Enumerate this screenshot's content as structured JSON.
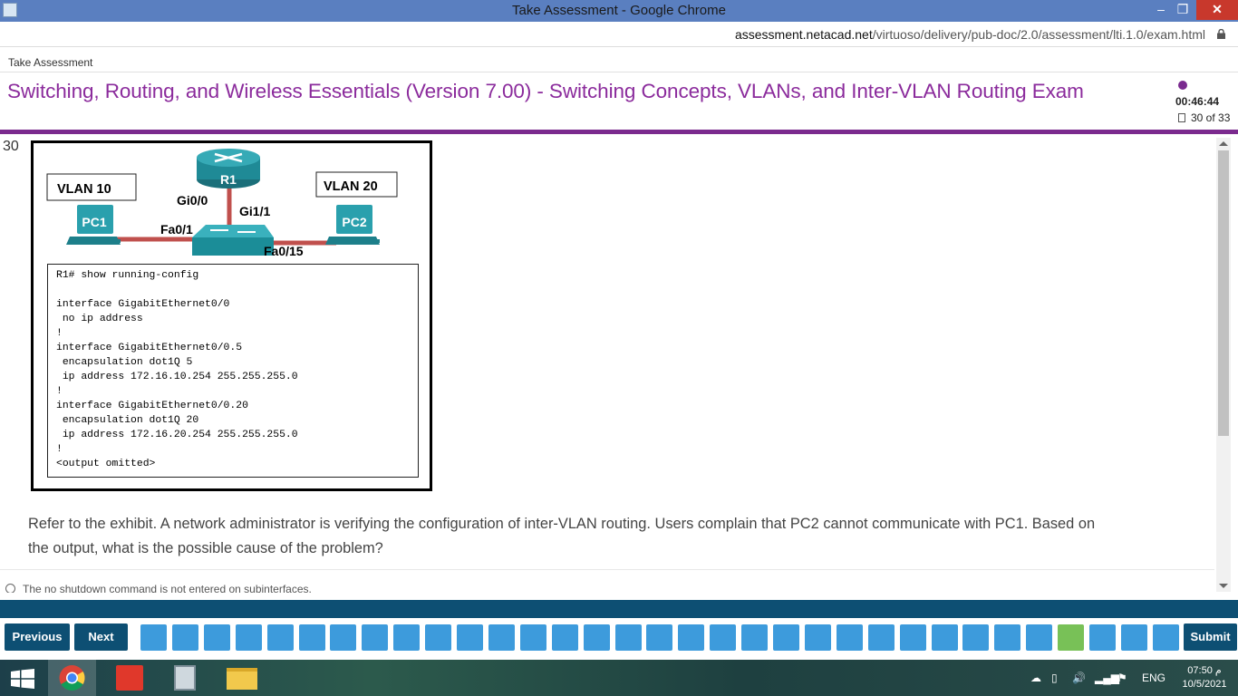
{
  "window": {
    "title": "Take Assessment - Google Chrome",
    "url_host": "assessment.netacad.net",
    "url_path": "/virtuoso/delivery/pub-doc/2.0/assessment/lti.1.0/exam.html"
  },
  "header": {
    "breadcrumb": "Take Assessment",
    "exam_title": "Switching, Routing, and Wireless Essentials (Version 7.00) - Switching Concepts, VLANs, and Inter-VLAN Routing Exam",
    "timer": "00:46:44",
    "progress": "30 of 33"
  },
  "question": {
    "number": "30",
    "text": "Refer to the exhibit. A network administrator is verifying the configuration of inter-VLAN routing. Users complain that PC2 cannot communicate with PC1. Based on the output, what is the possible cause of the problem?",
    "first_option": "The no shutdown command is not entered on subinterfaces."
  },
  "exhibit": {
    "vlan10": "VLAN 10",
    "vlan20": "VLAN 20",
    "router": "R1",
    "pc1": "PC1",
    "pc2": "PC2",
    "port_gi00": "Gi0/0",
    "port_gi11": "Gi1/1",
    "port_fa01": "Fa0/1",
    "port_fa015": "Fa0/15",
    "config": "R1# show running-config\n\ninterface GigabitEthernet0/0\n no ip address\n!\ninterface GigabitEthernet0/0.5\n encapsulation dot1Q 5\n ip address 172.16.10.254 255.255.255.0\n!\ninterface GigabitEthernet0/0.20\n encapsulation dot1Q 20\n ip address 172.16.20.254 255.255.255.0\n!\n<output omitted>"
  },
  "nav": {
    "previous": "Previous",
    "next": "Next",
    "submit": "Submit",
    "total_questions": 33,
    "current_question": 30
  },
  "taskbar": {
    "lang": "ENG",
    "time": "07:50 م",
    "date": "10/5/2021"
  },
  "colors": {
    "title_purple": "#8b2b9c",
    "nav_dark": "#0d4f73",
    "question_square": "#3d9bdc",
    "current_square": "#78c157"
  }
}
